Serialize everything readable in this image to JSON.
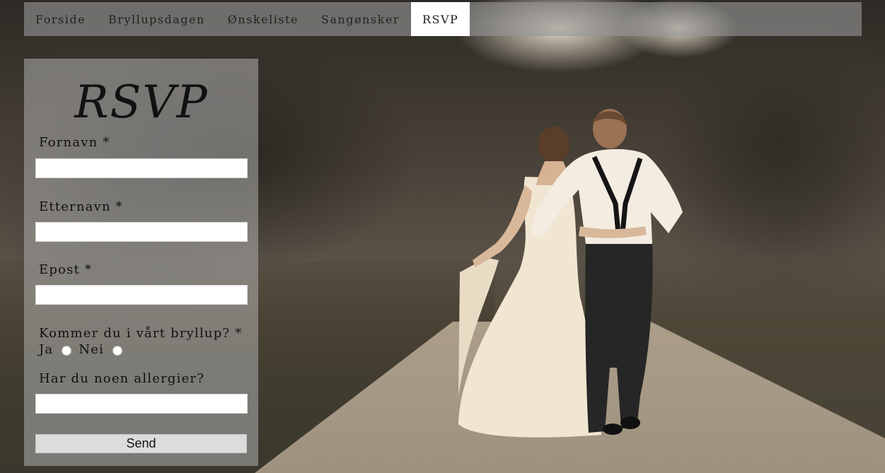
{
  "nav": {
    "items": [
      {
        "label": "Forside"
      },
      {
        "label": "Bryllupsdagen"
      },
      {
        "label": "Ønskeliste"
      },
      {
        "label": "Sangønsker"
      },
      {
        "label": "RSVP"
      }
    ],
    "active": "RSVP"
  },
  "form": {
    "title": "RSVP",
    "first_name_label": "Fornavn *",
    "first_name_value": "",
    "last_name_label": "Etternavn *",
    "last_name_value": "",
    "email_label": "Epost *",
    "email_value": "",
    "attending_label": "Kommer du i vårt bryllup? *",
    "option_yes": "Ja",
    "option_no": "Nei",
    "allergies_label": "Har du noen allergier?",
    "allergies_value": "",
    "submit_label": "Send"
  },
  "colors": {
    "nav_background": "#969696",
    "nav_active": "#ffffff",
    "panel_background": "#afafaf",
    "button_background": "#dcdcdc"
  }
}
